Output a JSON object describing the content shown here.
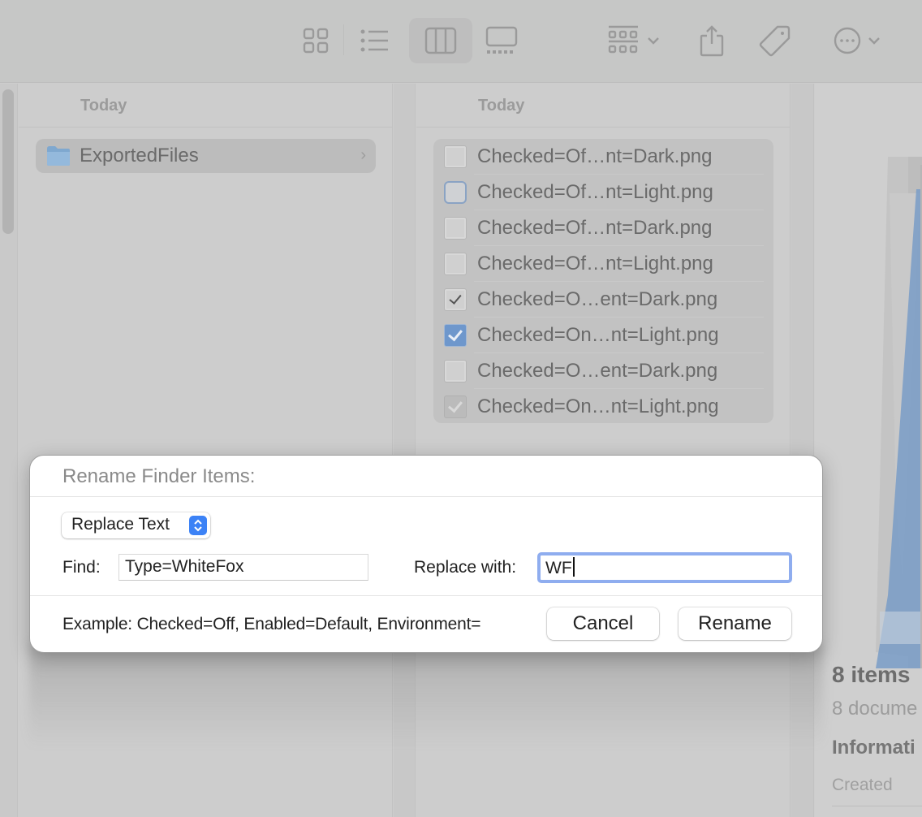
{
  "toolbar": {
    "buttons": [
      {
        "icon": "icon-view-icon",
        "active": false
      },
      {
        "icon": "list-view-icon",
        "active": false
      },
      {
        "icon": "column-view-icon",
        "active": true
      },
      {
        "icon": "gallery-view-icon",
        "active": false
      },
      {
        "icon": "group-by-icon",
        "has_dropdown": true
      },
      {
        "icon": "share-icon"
      },
      {
        "icon": "tag-icon"
      },
      {
        "icon": "more-actions-icon",
        "has_dropdown": true
      }
    ]
  },
  "columns": [
    {
      "header": "Today",
      "items": [
        {
          "name": "ExportedFiles",
          "kind": "folder",
          "selected": true
        }
      ]
    },
    {
      "header": "Today",
      "items": [
        {
          "name": "Checked=Of…nt=Dark.png",
          "thumb": "unchecked"
        },
        {
          "name": "Checked=Of…nt=Light.png",
          "thumb": "unchecked-focus"
        },
        {
          "name": "Checked=Of…nt=Dark.png",
          "thumb": "unchecked"
        },
        {
          "name": "Checked=Of…nt=Light.png",
          "thumb": "unchecked"
        },
        {
          "name": "Checked=O…ent=Dark.png",
          "thumb": "checked-dark"
        },
        {
          "name": "Checked=On…nt=Light.png",
          "thumb": "checked-blue"
        },
        {
          "name": "Checked=O…ent=Dark.png",
          "thumb": "unchecked"
        },
        {
          "name": "Checked=On…nt=Light.png",
          "thumb": "checked-gray"
        }
      ]
    }
  ],
  "preview": {
    "count": "8 items",
    "subtitle": "8 docume",
    "info_heading": "Informati",
    "created_label": "Created"
  },
  "rename_sheet": {
    "title": "Rename Finder Items:",
    "mode": "Replace Text",
    "find_label": "Find:",
    "find_value": "Type=WhiteFox",
    "replace_label": "Replace with:",
    "replace_value": "WF",
    "example": "Example: Checked=Off, Enabled=Default, Environment=",
    "cancel_label": "Cancel",
    "rename_label": "Rename",
    "accent_color": "#3c82f6",
    "focus_ring_color": "#8fadef"
  }
}
